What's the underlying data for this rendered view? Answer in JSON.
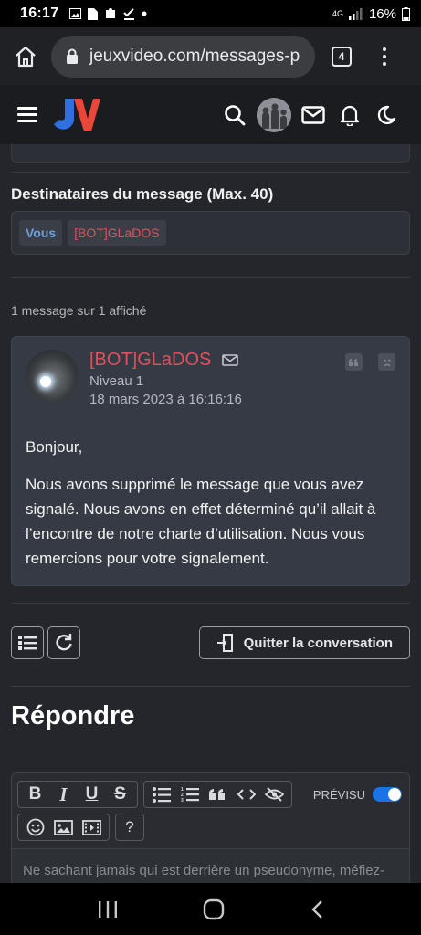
{
  "status_bar": {
    "time": "16:17",
    "network": "4G",
    "battery": "16%"
  },
  "browser": {
    "url": "jeuxvideo.com/messages-p",
    "tab_count": "4"
  },
  "recipients": {
    "title": "Destinataires du message (Max. 40)",
    "tags": [
      "Vous",
      "[BOT]GLaDOS"
    ]
  },
  "message_count": "1 message sur 1 affiché",
  "message": {
    "author": "[BOT]GLaDOS",
    "level": "Niveau 1",
    "date": "18 mars 2023 à 16:16:16",
    "paragraphs": [
      "Bonjour,",
      "Nous avons supprimé le message que vous avez signalé. Nous avons en effet déterminé qu’il allait à l’encontre de notre charte d’utilisation. Nous vous remercions pour votre signalement."
    ]
  },
  "actions": {
    "quit_label": "Quitter la conversation"
  },
  "reply": {
    "title": "Répondre",
    "preview_label": "PRÉVISU",
    "preview_enabled": true,
    "placeholder": "Ne sachant jamais qui est derrière un pseudonyme, méfiez-"
  },
  "colors": {
    "author": "#e0505a",
    "accent_blue": "#1a73e8",
    "background": "#24262b"
  }
}
